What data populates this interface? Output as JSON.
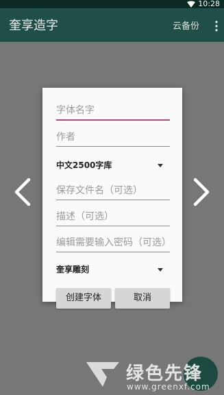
{
  "status": {
    "time": "10:28"
  },
  "appbar": {
    "title": "奎享造字",
    "cloud_label": "云备份"
  },
  "dialog": {
    "font_name_placeholder": "字体名字",
    "author_placeholder": "作者",
    "charset_selected": "中文2500字库",
    "filename_placeholder": "保存文件名（可选）",
    "description_placeholder": "描述（可选）",
    "password_placeholder": "编辑需要输入密码（可选）",
    "style_selected": "奎享雕刻",
    "create_label": "创建字体",
    "cancel_label": "取消"
  },
  "watermark": {
    "brand": "绿色先锋",
    "url": "www.greenxf.com"
  },
  "colors": {
    "appbar": "#1f4f46",
    "statusbar": "#0b2a24",
    "accent": "#b64a78",
    "scrim": "#777777"
  },
  "icons": [
    "wifi-icon",
    "more-vert-icon",
    "chevron-left-icon",
    "chevron-right-icon",
    "dropdown-arrow-icon",
    "watermark-logo"
  ]
}
